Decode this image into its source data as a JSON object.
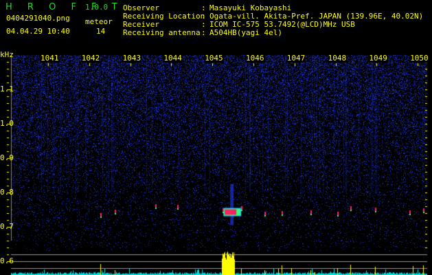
{
  "app": {
    "name": "H R O F F T",
    "version": "1.0.0"
  },
  "file": {
    "name": "0404291040.png",
    "datetime": "04.04.29 10:40"
  },
  "meteor": {
    "label": "meteor",
    "count": "14"
  },
  "info": [
    {
      "label": "Observer",
      "value": "Masayuki Kobayashi"
    },
    {
      "label": "Receiving Location",
      "value": "Ogata-vill. Akita-Pref. JAPAN (139.96E, 40.02N)"
    },
    {
      "label": "Receiver",
      "value": "ICOM IC-575 53.7492(@LCD)MHz USB"
    },
    {
      "label": "Receiving antenna",
      "value": "A504HB(yagi 4el)"
    }
  ],
  "chart_data": {
    "type": "heatmap",
    "ylabel": "kHz",
    "x_tick_labels": [
      "1041",
      "1042",
      "1043",
      "1044",
      "1045",
      "1046",
      "1047",
      "1048",
      "1049",
      "1050"
    ],
    "y_tick_labels": [
      "1.1",
      "1.0",
      "0.9",
      "0.8",
      "0.7",
      "0.6"
    ],
    "ylim": [
      0.6,
      1.2
    ],
    "main_echo": {
      "time": "1045.5",
      "freq_khz": 0.745
    },
    "colors": {
      "background": "#000000",
      "noise": "#1a2ccc",
      "echo": "#ff2060",
      "text": "#ffff00",
      "level_bars": "#00e0e0",
      "detection_bars": "#ffff00",
      "logo": "#22dd22"
    }
  }
}
